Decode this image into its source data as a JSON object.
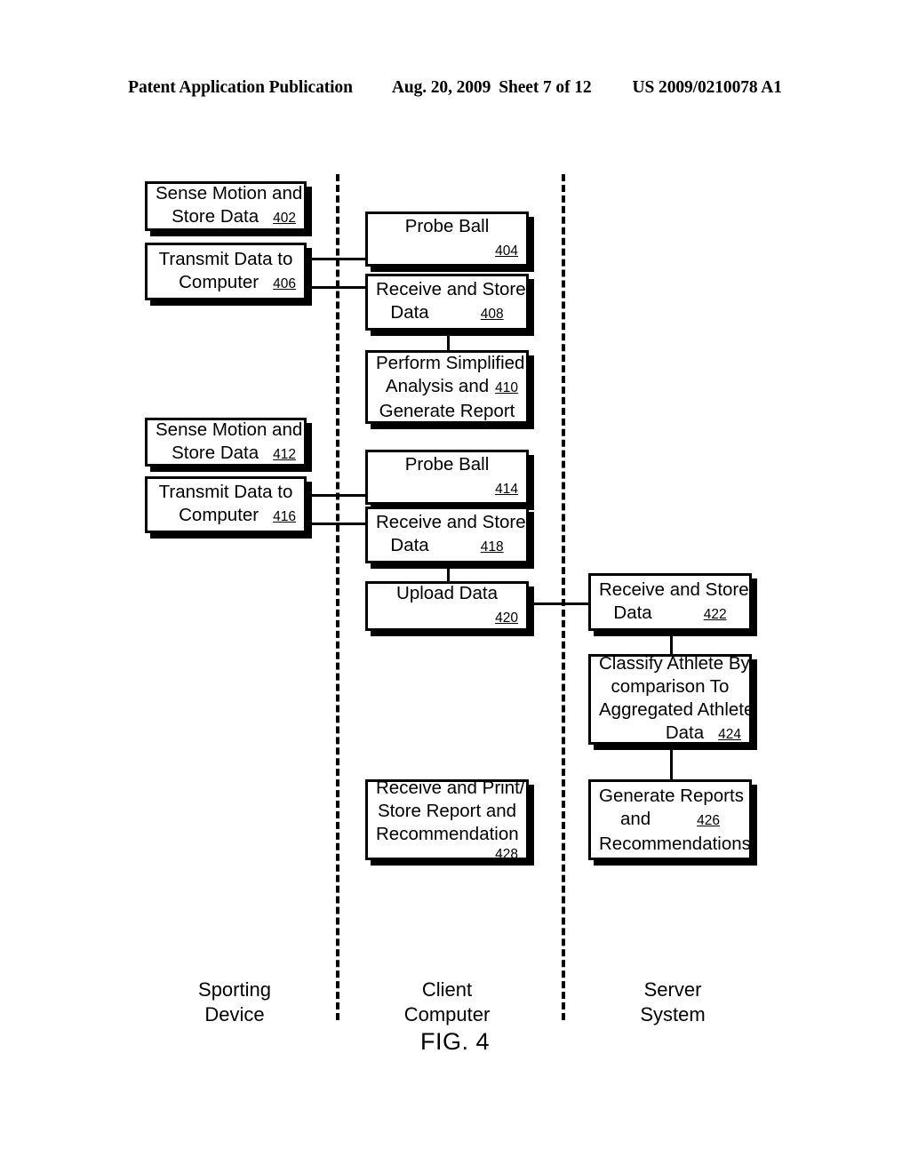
{
  "header": {
    "publication": "Patent Application Publication",
    "date": "Aug. 20, 2009",
    "sheet": "Sheet 7 of 12",
    "patent_number": "US 2009/0210078 A1"
  },
  "figure": {
    "label": "FIG. 4",
    "ink_color": "#000000",
    "background_color": "#ffffff"
  },
  "lanes": [
    {
      "id": "sporting-device",
      "line1": "Sporting",
      "line2": "Device"
    },
    {
      "id": "client-computer",
      "line1": "Client",
      "line2": "Computer"
    },
    {
      "id": "server-system",
      "line1": "Server",
      "line2": "System"
    }
  ],
  "boxes": [
    {
      "ref": "402",
      "lane": "sporting-device",
      "line1": "Sense Motion and",
      "line2": "Store Data"
    },
    {
      "ref": "406",
      "lane": "sporting-device",
      "line1": "Transmit Data to",
      "line2": "Computer"
    },
    {
      "ref": "404",
      "lane": "client-computer",
      "line1": "Probe Ball"
    },
    {
      "ref": "408",
      "lane": "client-computer",
      "line1": "Receive and Store",
      "line2": "Data"
    },
    {
      "ref": "410",
      "lane": "client-computer",
      "line1": "Perform Simplified",
      "line2": "Analysis and",
      "line3": "Generate Report"
    },
    {
      "ref": "412",
      "lane": "sporting-device",
      "line1": "Sense Motion and",
      "line2": "Store Data"
    },
    {
      "ref": "416",
      "lane": "sporting-device",
      "line1": "Transmit Data to",
      "line2": "Computer"
    },
    {
      "ref": "414",
      "lane": "client-computer",
      "line1": "Probe Ball"
    },
    {
      "ref": "418",
      "lane": "client-computer",
      "line1": "Receive and Store",
      "line2": "Data"
    },
    {
      "ref": "420",
      "lane": "client-computer",
      "line1": "Upload Data"
    },
    {
      "ref": "422",
      "lane": "server-system",
      "line1": "Receive and Store",
      "line2": "Data"
    },
    {
      "ref": "424",
      "lane": "server-system",
      "line1": "Classify Athlete By",
      "line2": "comparison To",
      "line3": "Aggregated Athlete",
      "line4": "Data"
    },
    {
      "ref": "428",
      "lane": "client-computer",
      "line1": "Receive and Print/",
      "line2": "Store Report and",
      "line3": "Recommendation"
    },
    {
      "ref": "426",
      "lane": "server-system",
      "line1": "Generate Reports",
      "line2": "and",
      "line3": "Recommendations"
    }
  ]
}
